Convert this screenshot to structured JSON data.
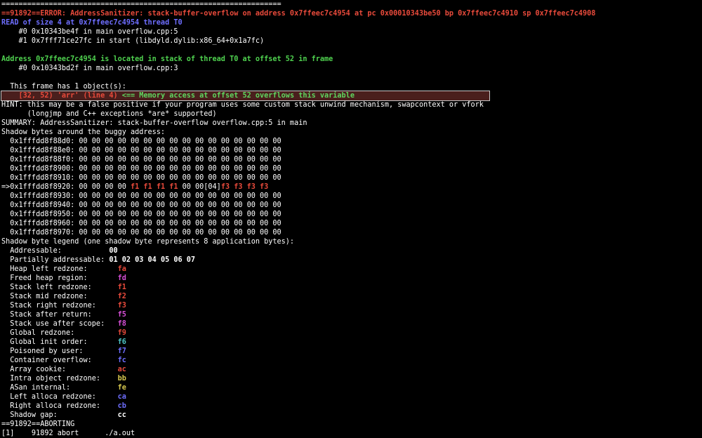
{
  "colors": {
    "background": "#000000",
    "error": "#e84a3b",
    "read_info": "#6e6eff",
    "address_info": "#4fd24f",
    "highlight_bg": "#4a1f1d",
    "fa": "#e84a3b",
    "fd": "#d64fd6",
    "f1": "#e84a3b",
    "f2": "#e84a3b",
    "f3": "#e84a3b",
    "f5": "#d64fd6",
    "f8": "#d64fd6",
    "f9": "#e84a3b",
    "f6": "#4fc8c8",
    "f7": "#6e6eff",
    "fc": "#6e6eff",
    "ac": "#e84a3b",
    "bb": "#d6c84f",
    "fe": "#d6c84f",
    "ca": "#6e6eff",
    "cb": "#6e6eff",
    "cc": "#ffffff"
  },
  "terminal": {
    "separator": "=================================================================",
    "error_line": "==91892==ERROR: AddressSanitizer: stack-buffer-overflow on address 0x7ffeec7c4954 at pc 0x00010343be50 bp 0x7ffeec7c4910 sp 0x7ffeec7c4908",
    "read_line": "READ of size 4 at 0x7ffeec7c4954 thread T0",
    "frames": [
      "    #0 0x10343be4f in main overflow.cpp:5",
      "    #1 0x7fff71ce27fc in start (libdyld.dylib:x86_64+0x1a7fc)"
    ],
    "address_line": "Address 0x7ffeec7c4954 is located in stack of thread T0 at offset 52 in frame",
    "frame_line": "    #0 0x10343bd2f in main overflow.cpp:3",
    "objects_line": "  This frame has 1 object(s):",
    "object_entry": "    [32, 52) 'arr' (line 4)",
    "object_msg": " <== Memory access at offset 52 overflows this variable",
    "hint_1": "HINT: this may be a false positive if your program uses some custom stack unwind mechanism, swapcontext or vfork",
    "hint_2": "      (longjmp and C++ exceptions *are* supported)",
    "summary": "SUMMARY: AddressSanitizer: stack-buffer-overflow overflow.cpp:5 in main",
    "shadow_header": "Shadow bytes around the buggy address:",
    "shadow_rows_before": [
      "  0x1fffdd8f88d0: 00 00 00 00 00 00 00 00 00 00 00 00 00 00 00 00",
      "  0x1fffdd8f88e0: 00 00 00 00 00 00 00 00 00 00 00 00 00 00 00 00",
      "  0x1fffdd8f88f0: 00 00 00 00 00 00 00 00 00 00 00 00 00 00 00 00",
      "  0x1fffdd8f8900: 00 00 00 00 00 00 00 00 00 00 00 00 00 00 00 00",
      "  0x1fffdd8f8910: 00 00 00 00 00 00 00 00 00 00 00 00 00 00 00 00"
    ],
    "buggy_row_prefix": "=>0x1fffdd8f8920: 00 00 00 00 ",
    "buggy_row_f1": "f1 f1 f1 f1",
    "buggy_row_mid": " 00 00[04]",
    "buggy_row_f3": "f3 f3 f3 f3",
    "shadow_rows_after": [
      "  0x1fffdd8f8930: 00 00 00 00 00 00 00 00 00 00 00 00 00 00 00 00",
      "  0x1fffdd8f8940: 00 00 00 00 00 00 00 00 00 00 00 00 00 00 00 00",
      "  0x1fffdd8f8950: 00 00 00 00 00 00 00 00 00 00 00 00 00 00 00 00",
      "  0x1fffdd8f8960: 00 00 00 00 00 00 00 00 00 00 00 00 00 00 00 00",
      "  0x1fffdd8f8970: 00 00 00 00 00 00 00 00 00 00 00 00 00 00 00 00"
    ],
    "legend_header": "Shadow byte legend (one shadow byte represents 8 application bytes):",
    "legend": [
      {
        "label": "  Addressable:           ",
        "code": "00",
        "color": "#ffffff"
      },
      {
        "label": "  Partially addressable: ",
        "code": "01 02 03 04 05 06 07",
        "color": "#ffffff"
      },
      {
        "label": "  Heap left redzone:       ",
        "code": "fa",
        "color": "#e84a3b"
      },
      {
        "label": "  Freed heap region:       ",
        "code": "fd",
        "color": "#d64fd6"
      },
      {
        "label": "  Stack left redzone:      ",
        "code": "f1",
        "color": "#e84a3b"
      },
      {
        "label": "  Stack mid redzone:       ",
        "code": "f2",
        "color": "#e84a3b"
      },
      {
        "label": "  Stack right redzone:     ",
        "code": "f3",
        "color": "#e84a3b"
      },
      {
        "label": "  Stack after return:      ",
        "code": "f5",
        "color": "#d64fd6"
      },
      {
        "label": "  Stack use after scope:   ",
        "code": "f8",
        "color": "#d64fd6"
      },
      {
        "label": "  Global redzone:          ",
        "code": "f9",
        "color": "#e84a3b"
      },
      {
        "label": "  Global init order:       ",
        "code": "f6",
        "color": "#4fc8c8"
      },
      {
        "label": "  Poisoned by user:        ",
        "code": "f7",
        "color": "#6e6eff"
      },
      {
        "label": "  Container overflow:      ",
        "code": "fc",
        "color": "#6e6eff"
      },
      {
        "label": "  Array cookie:            ",
        "code": "ac",
        "color": "#e84a3b"
      },
      {
        "label": "  Intra object redzone:    ",
        "code": "bb",
        "color": "#d6c84f"
      },
      {
        "label": "  ASan internal:           ",
        "code": "fe",
        "color": "#d6c84f"
      },
      {
        "label": "  Left alloca redzone:     ",
        "code": "ca",
        "color": "#6e6eff"
      },
      {
        "label": "  Right alloca redzone:    ",
        "code": "cb",
        "color": "#6e6eff"
      },
      {
        "label": "  Shadow gap:              ",
        "code": "cc",
        "color": "#ffffff"
      }
    ],
    "aborting": "==91892==ABORTING",
    "job_line": "[1]    91892 abort      ./a.out"
  }
}
